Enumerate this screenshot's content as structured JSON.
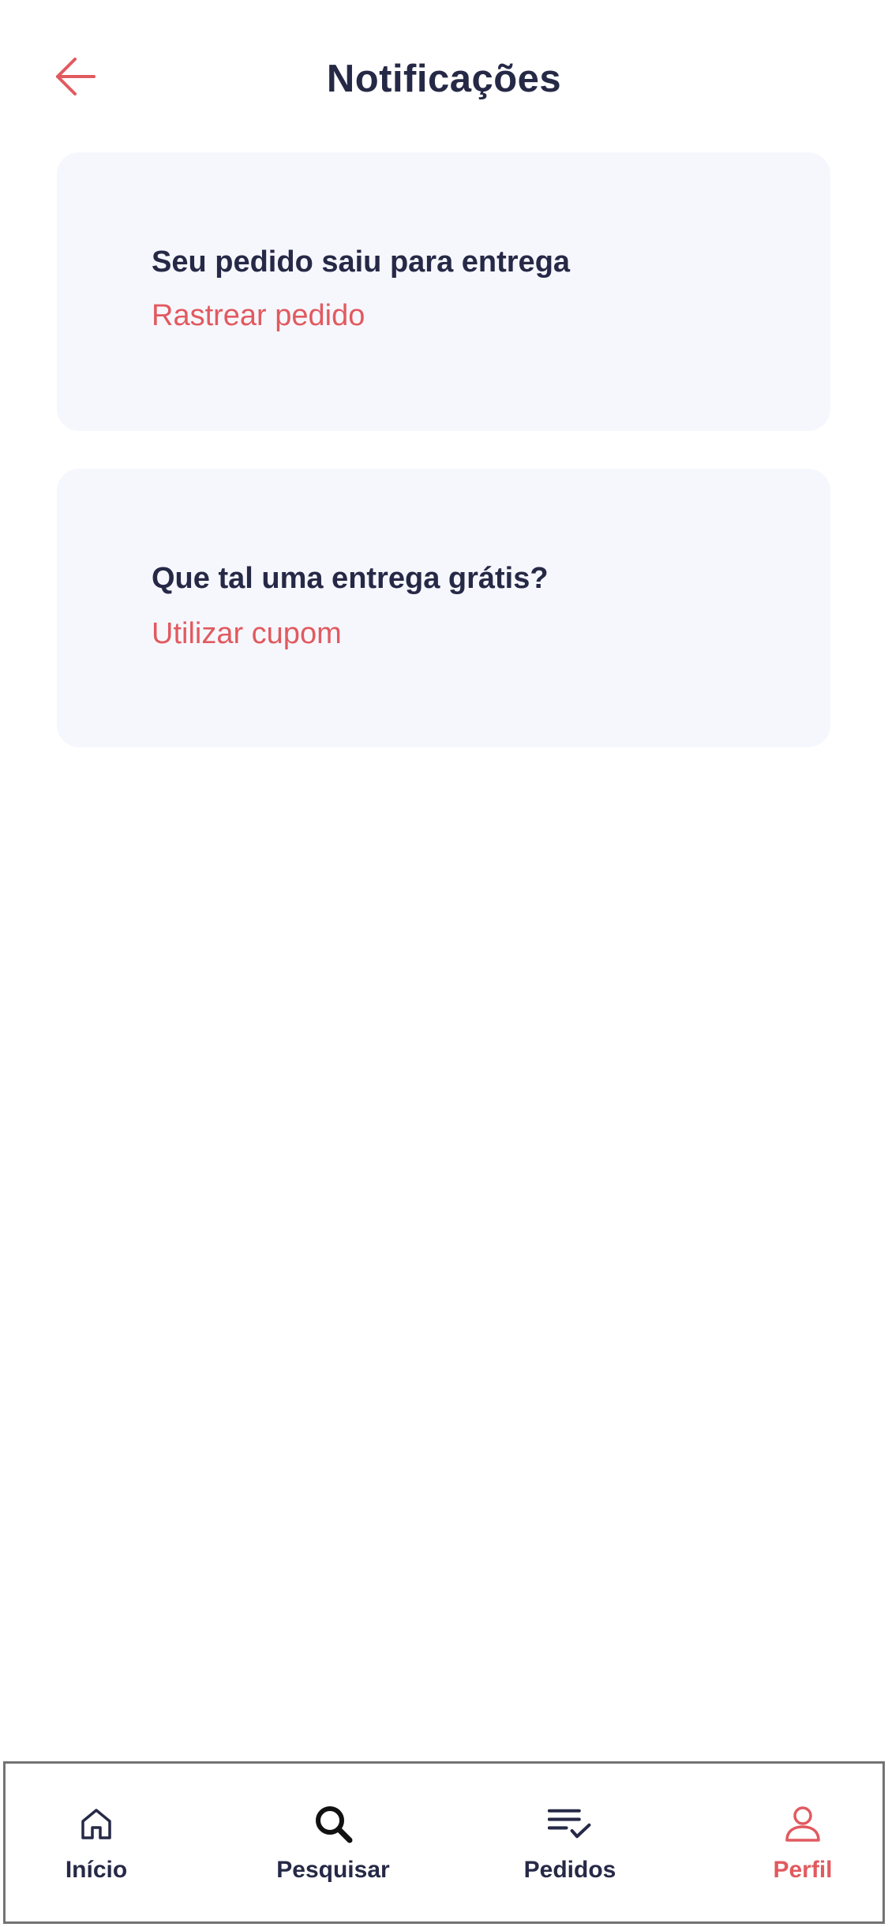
{
  "header": {
    "title": "Notificações",
    "back_icon": "arrow-left-icon"
  },
  "notifications": [
    {
      "title": "Seu pedido saiu para entrega",
      "action": "Rastrear pedido"
    },
    {
      "title": "Que tal uma entrega grátis?",
      "action": "Utilizar cupom"
    }
  ],
  "bottom_nav": {
    "items": [
      {
        "label": "Início",
        "icon": "home-icon",
        "active": false
      },
      {
        "label": "Pesquisar",
        "icon": "search-icon",
        "active": false
      },
      {
        "label": "Pedidos",
        "icon": "list-check-icon",
        "active": false
      },
      {
        "label": "Perfil",
        "icon": "user-icon",
        "active": true
      }
    ]
  },
  "colors": {
    "accent": "#e15a5f",
    "text_dark": "#262946",
    "card_background": "#f6f7fd",
    "nav_border": "#737373"
  }
}
